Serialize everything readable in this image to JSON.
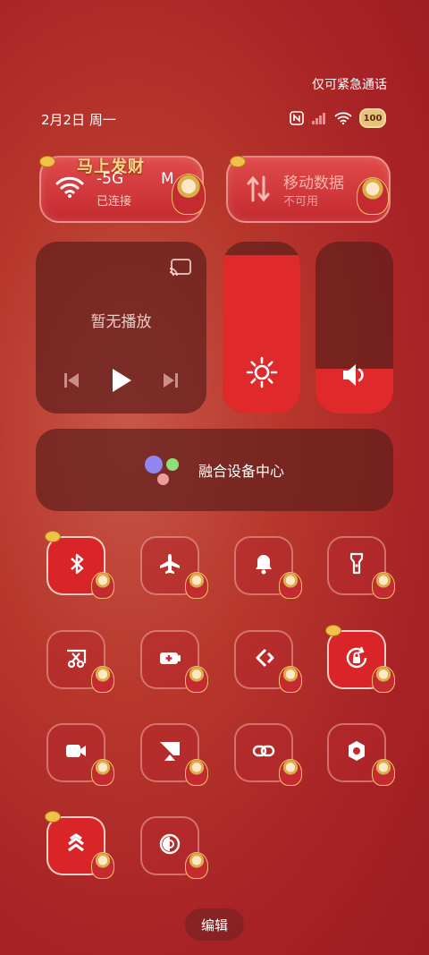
{
  "status_bar": {
    "emergency_text": "仅可紧急通话",
    "date_text": "2月2日 周一",
    "battery_level": "100",
    "icons": [
      "nfc-icon",
      "signal-icon",
      "wifi-icon",
      "battery-icon"
    ]
  },
  "wifi_tile": {
    "banner": "马上发财",
    "title": "-5G",
    "title_suffix": "M",
    "status": "已连接"
  },
  "data_tile": {
    "title": "移动数据",
    "status": "不可用"
  },
  "media": {
    "label": "暂无播放"
  },
  "brightness": {
    "level": 0.92
  },
  "volume": {
    "level": 0.26
  },
  "fusion": {
    "label": "融合设备中心"
  },
  "toggles": [
    {
      "icon": "bluetooth-icon",
      "on": true
    },
    {
      "icon": "airplane-icon",
      "on": false
    },
    {
      "icon": "bell-icon",
      "on": false
    },
    {
      "icon": "flashlight-icon",
      "on": false
    },
    {
      "icon": "screenshot-icon",
      "on": false
    },
    {
      "icon": "battery-saver-icon",
      "on": false
    },
    {
      "icon": "share-icon",
      "on": false
    },
    {
      "icon": "rotation-lock-icon",
      "on": true
    },
    {
      "icon": "screen-record-icon",
      "on": false
    },
    {
      "icon": "screen-cast-icon",
      "on": false
    },
    {
      "icon": "link-icon",
      "on": false
    },
    {
      "icon": "settings-icon",
      "on": false
    },
    {
      "icon": "performance-icon",
      "on": true
    },
    {
      "icon": "eye-comfort-icon",
      "on": false
    }
  ],
  "edit_label": "编辑",
  "colors": {
    "accent": "#e0292b",
    "panel": "#5f1e1c",
    "coin": "#f2c14b"
  }
}
